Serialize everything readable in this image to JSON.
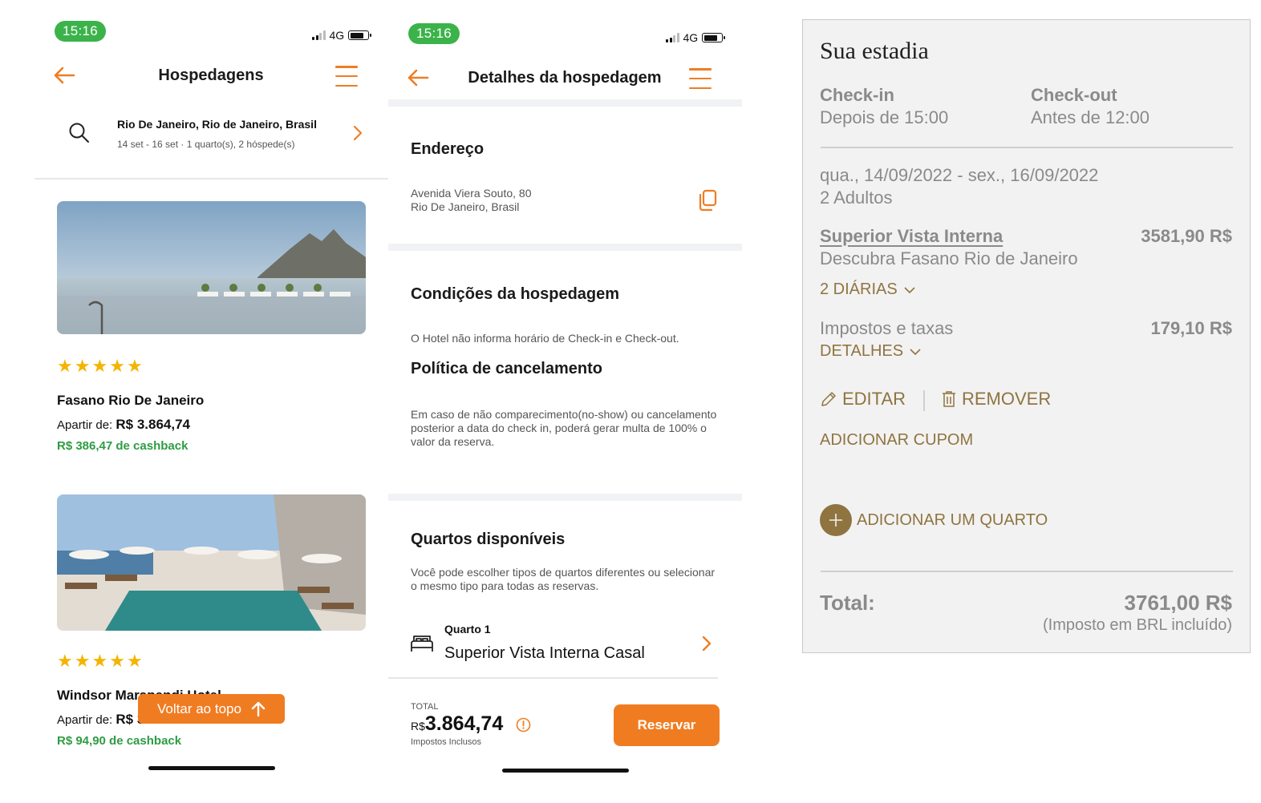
{
  "colors": {
    "accent": "#ef7d22",
    "time_pill": "#3bb34a",
    "cashback": "#2e9c43",
    "stars": "#f4b400",
    "gold": "#8f7440"
  },
  "panel1": {
    "status": {
      "time": "15:16",
      "network": "4G"
    },
    "title": "Hospedagens",
    "search": {
      "destination": "Rio De Janeiro, Rio de Janeiro, Brasil",
      "details": "14 set - 16 set · 1 quarto(s), 2 hóspede(s)"
    },
    "hotels": [
      {
        "name": "Fasano Rio De Janeiro",
        "rating": 5,
        "price_label": "Apartir de:",
        "price": "R$ 3.864,74",
        "cashback": "R$ 386,47 de cashback"
      },
      {
        "name": "Windsor Marapendi Hotel",
        "rating": 5,
        "price_label": "Apartir de:",
        "price": "R$ 3",
        "cashback": "R$ 94,90 de cashback"
      }
    ],
    "back_to_top": "Voltar ao topo"
  },
  "panel2": {
    "status": {
      "time": "15:16",
      "network": "4G"
    },
    "title": "Detalhes da hospedagem",
    "address": {
      "title": "Endereço",
      "line1": "Avenida Viera Souto, 80",
      "line2": "Rio De Janeiro, Brasil"
    },
    "conditions": {
      "title": "Condições da hospedagem",
      "text": "O Hotel não informa horário de Check-in e Check-out."
    },
    "cancellation": {
      "title": "Política de cancelamento",
      "text": "Em caso de não comparecimento(no-show) ou cancelamento posterior a data do check in, poderá gerar multa de 100% o valor da reserva."
    },
    "rooms": {
      "title": "Quartos disponíveis",
      "text": "Você pode escolher tipos de quartos diferentes ou selecionar o mesmo tipo para todas as reservas.",
      "room_label": "Quarto 1",
      "room_name": "Superior Vista Interna Casal"
    },
    "footer": {
      "total_label": "TOTAL",
      "currency": "R$",
      "amount": "3.864,74",
      "taxes_note": "Impostos Inclusos",
      "reserve_label": "Reservar"
    }
  },
  "panel3": {
    "title": "Sua estadia",
    "checkin_label": "Check-in",
    "checkin_value": "Depois de 15:00",
    "checkout_label": "Check-out",
    "checkout_value": "Antes de 12:00",
    "dates": "qua., 14/09/2022 - sex., 16/09/2022",
    "guests": "2 Adultos",
    "room_name": "Superior Vista Interna",
    "room_price": "3581,90 R$",
    "room_rate": "Descubra Fasano Rio de Janeiro",
    "nights": "2 DIÁRIAS",
    "taxes_label": "Impostos e taxas",
    "taxes_value": "179,10 R$",
    "taxes_details": "DETALHES",
    "edit_label": "EDITAR",
    "remove_label": "REMOVER",
    "coupon_label": "ADICIONAR CUPOM",
    "add_room_label": "ADICIONAR UM QUARTO",
    "total_label": "Total:",
    "total_value": "3761,00 R$",
    "total_note": "(Imposto em BRL incluído)"
  }
}
